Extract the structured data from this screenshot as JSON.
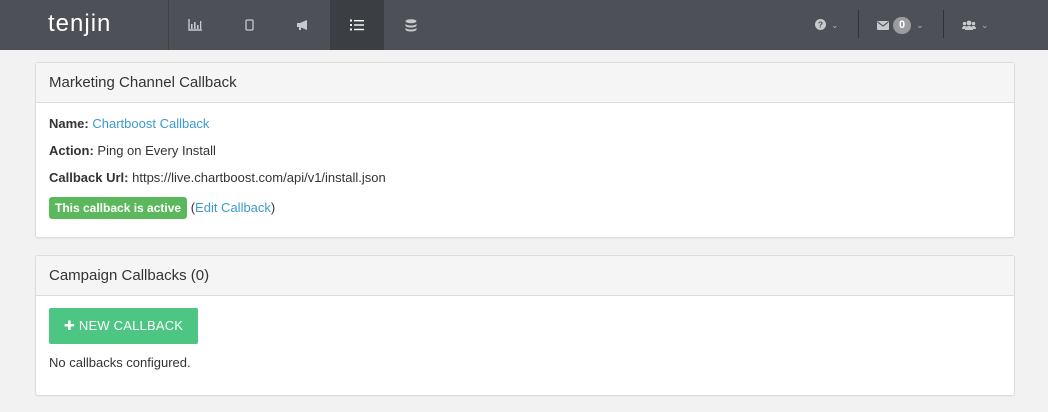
{
  "app": {
    "brand": "tenjin"
  },
  "nav": {
    "items": [
      {
        "icon": "bar-chart-icon",
        "active": false
      },
      {
        "icon": "mobile-icon",
        "active": false
      },
      {
        "icon": "megaphone-icon",
        "active": false
      },
      {
        "icon": "list-icon",
        "active": true
      },
      {
        "icon": "database-icon",
        "active": false
      }
    ],
    "right": {
      "help_icon": "question-circle-icon",
      "mail_icon": "envelope-icon",
      "mail_count": "0",
      "users_icon": "users-icon"
    }
  },
  "channel_panel": {
    "title": "Marketing Channel Callback",
    "name_label": "Name:",
    "name_value": "Chartboost Callback",
    "action_label": "Action:",
    "action_value": "Ping on Every Install",
    "url_label": "Callback Url:",
    "url_value": "https://live.chartboost.com/api/v1/install.json",
    "status": "This callback is active",
    "paren_open": "(",
    "edit_link": "Edit Callback",
    "paren_close": ")"
  },
  "campaign_panel": {
    "title": "Campaign Callbacks (0)",
    "new_button": "NEW CALLBACK",
    "empty_text": "No callbacks configured."
  },
  "colors": {
    "topbar": "#4d5057",
    "link": "#3d9ad1",
    "active_label": "#5cb85c",
    "new_button": "#4cc682"
  }
}
